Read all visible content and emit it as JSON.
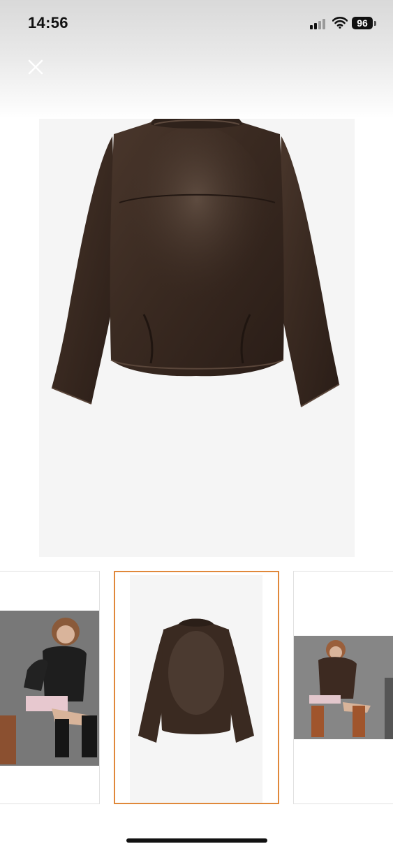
{
  "status_bar": {
    "time": "14:56",
    "battery": "96",
    "icons": [
      "signal-icon",
      "wifi-icon",
      "battery-icon"
    ]
  },
  "viewer": {
    "close_icon": "close-icon",
    "main_image": "brown-leather-jacket-back-view",
    "thumbnails": [
      {
        "subject": "model-in-black-leather-jacket-seated",
        "selected": false
      },
      {
        "subject": "brown-leather-jacket-back-view",
        "selected": true
      },
      {
        "subject": "model-in-brown-jacket-seated",
        "selected": false
      }
    ]
  },
  "colors": {
    "selected_border": "#e0883a",
    "jacket": "#3b2a22",
    "image_background": "#f5f5f5"
  }
}
